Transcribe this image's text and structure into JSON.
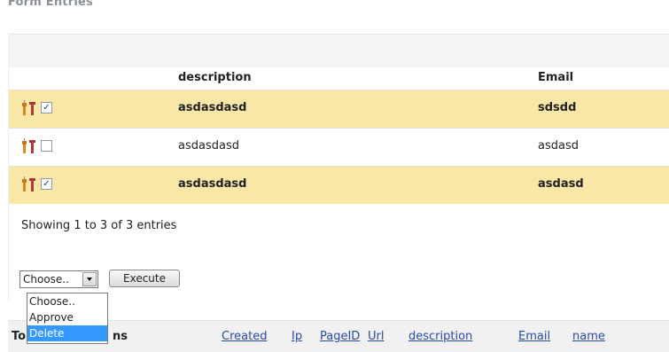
{
  "page": {
    "title": "Form Entries"
  },
  "table": {
    "headers": {
      "description": "description",
      "email": "Email"
    },
    "rows": [
      {
        "description": "asdasdasd",
        "email": "sdsdd",
        "checked": true
      },
      {
        "description": "asdasdasd",
        "email": "asdasd",
        "checked": false
      },
      {
        "description": "asdasdasd",
        "email": "asdasd",
        "checked": true
      }
    ],
    "check_mark": "✓",
    "showing": "Showing 1 to 3 of 3 entries"
  },
  "actions": {
    "select_value": "Choose..",
    "execute_label": "Execute",
    "options": [
      "Choose..",
      "Approve",
      "Delete"
    ],
    "highlighted_option": "Delete"
  },
  "bottom": {
    "label_left": "To",
    "label_right": "ns",
    "columns": [
      "Created",
      "Ip",
      "PageID",
      "Url",
      "description",
      "Email",
      "name"
    ]
  },
  "colors": {
    "row_selected": "#f8e7a6",
    "link": "#2a4aa8",
    "dropdown_highlight": "#3399ff"
  },
  "icons": {
    "row_tools": "tools-icon",
    "select_arrow": "chevron-down-icon"
  }
}
